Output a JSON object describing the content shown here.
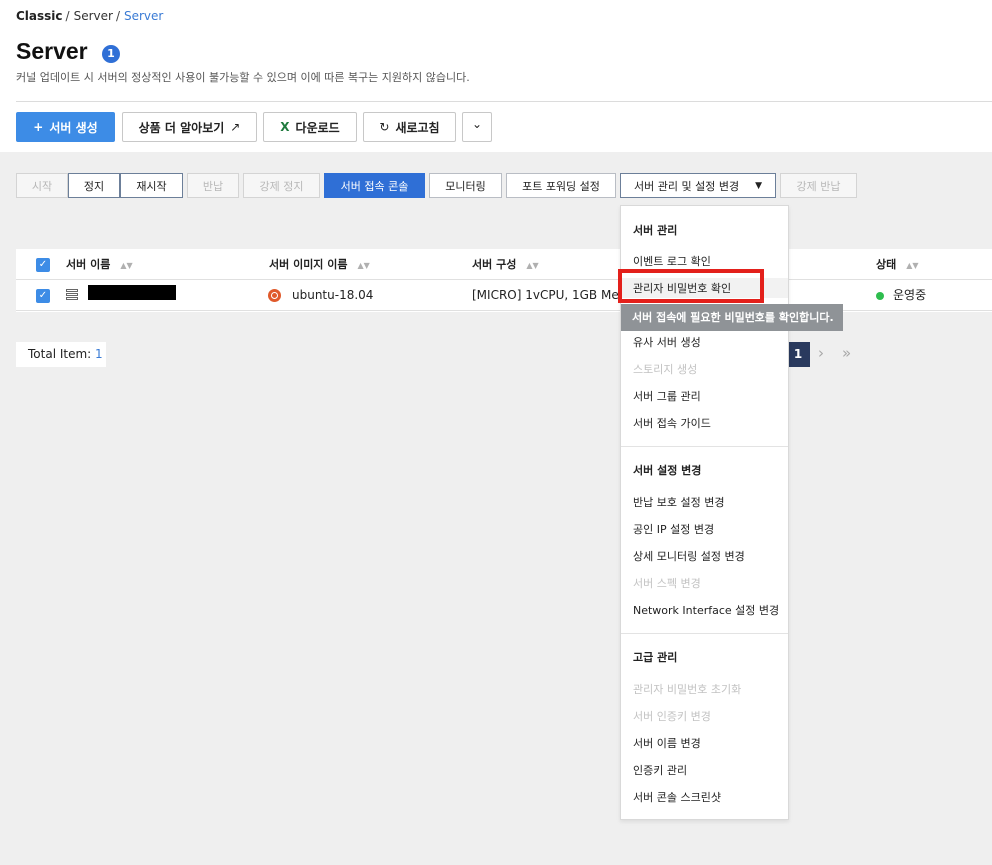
{
  "breadcrumb": {
    "root": "Classic",
    "sep1": "/",
    "mid": "Server",
    "sep2": "/",
    "current": "Server"
  },
  "page": {
    "title": "Server",
    "count_badge": "1",
    "subtitle": "커널 업데이트 시 서버의 정상적인 사용이 불가능할 수 있으며 이에 따른 복구는 지원하지 않습니다."
  },
  "toolbar": {
    "create_icon": "+",
    "create_label": "서버 생성",
    "learn_more_label": "상품 더 알아보기",
    "learn_more_icon": "↗",
    "download_icon": "X",
    "download_label": "다운로드",
    "refresh_icon": "↻",
    "refresh_label": "새로고침",
    "more_icon": "⌄"
  },
  "actions": {
    "start": "시작",
    "stop": "정지",
    "restart": "재시작",
    "return": "반납",
    "force_stop": "강제 정지",
    "console": "서버 접속 콘솔",
    "monitoring": "모니터링",
    "port_forwarding": "포트 포워딩 설정",
    "manage": "서버 관리 및 설정 변경",
    "manage_caret": "▼",
    "force_return": "강제 반납"
  },
  "table": {
    "columns": [
      "서버 이름",
      "서버 이미지 이름",
      "서버 구성",
      "상태"
    ],
    "sort_icon": "▲▼",
    "rows": [
      {
        "image": "ubuntu-18.04",
        "spec": "[MICRO] 1vCPU, 1GB Mem",
        "status": "운영중"
      }
    ],
    "check_mark": "✓"
  },
  "footer": {
    "total_label": "Total Item:",
    "total_value": "1",
    "page_current": "1",
    "next_icon": "›",
    "last_icon": "»"
  },
  "dropdown": {
    "sections": [
      {
        "header": "서버 관리",
        "items": [
          {
            "label": "이벤트 로그 확인",
            "enabled": true
          },
          {
            "label": "관리자 비밀번호 확인",
            "enabled": true
          },
          {
            "label": "유사 서버 생성",
            "enabled": true
          },
          {
            "label": "스토리지 생성",
            "enabled": false
          },
          {
            "label": "서버 그룹 관리",
            "enabled": true
          },
          {
            "label": "서버 접속 가이드",
            "enabled": true
          }
        ]
      },
      {
        "header": "서버 설정 변경",
        "items": [
          {
            "label": "반납 보호 설정 변경",
            "enabled": true
          },
          {
            "label": "공인 IP 설정 변경",
            "enabled": true
          },
          {
            "label": "상세 모니터링 설정 변경",
            "enabled": true
          },
          {
            "label": "서버 스펙 변경",
            "enabled": false
          },
          {
            "label": "Network Interface 설정 변경",
            "enabled": true
          }
        ]
      },
      {
        "header": "고급 관리",
        "items": [
          {
            "label": "관리자 비밀번호 초기화",
            "enabled": false
          },
          {
            "label": "서버 인증키 변경",
            "enabled": false
          },
          {
            "label": "서버 이름 변경",
            "enabled": true
          },
          {
            "label": "인증키 관리",
            "enabled": true
          },
          {
            "label": "서버 콘솔 스크린샷",
            "enabled": true
          }
        ]
      }
    ],
    "tooltip": "서버 접속에 필요한 비밀번호를 확인합니다."
  },
  "colors": {
    "primary": "#3d8ce6",
    "console": "#2f6fd6",
    "highlight": "#e3201b",
    "status_ok": "#2ebd4e"
  }
}
